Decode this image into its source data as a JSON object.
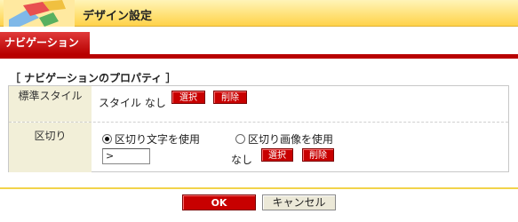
{
  "window": {
    "title": "デザイン設定",
    "icon": "palette-book-icon"
  },
  "tabs": [
    {
      "label": "ナビゲーション",
      "active": true
    }
  ],
  "section": {
    "title": "［ ナビゲーションのプロパティ ］"
  },
  "standard_style": {
    "label": "標準スタイル",
    "value": "スタイル なし",
    "select_label": "選択",
    "delete_label": "削除"
  },
  "separator": {
    "label": "区切り",
    "option_text_label": "区切り文字を使用",
    "option_text_checked": true,
    "option_image_label": "区切り画像を使用",
    "option_image_checked": false,
    "text_value": ">",
    "image_value": "なし",
    "select_label": "選択",
    "delete_label": "削除"
  },
  "footer": {
    "ok_label": "OK",
    "cancel_label": "キャンセル"
  },
  "colors": {
    "accent_red": "#c80000",
    "title_yellow": "#ffe27a",
    "label_bg": "#f2efd8"
  }
}
